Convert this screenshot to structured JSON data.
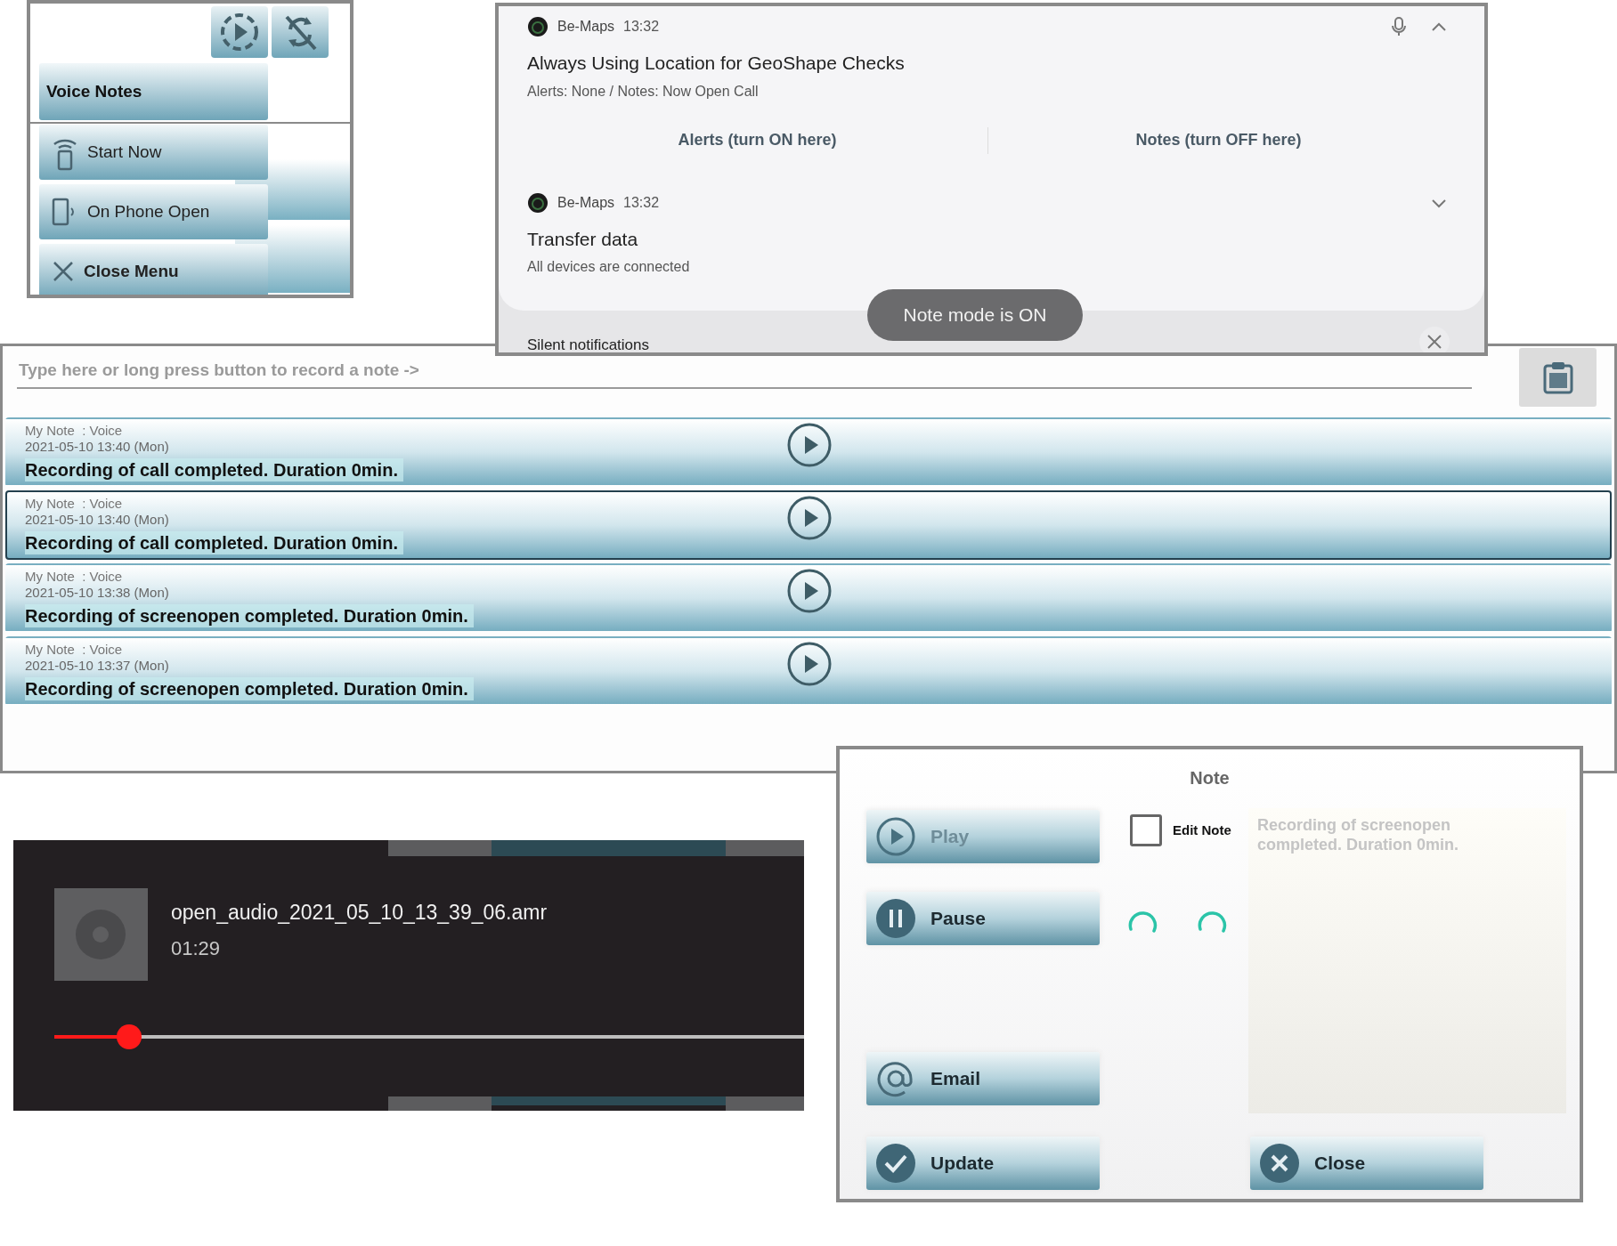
{
  "voice_menu": {
    "toolbar": [
      {
        "kind": "play"
      },
      {
        "kind": "sync_off"
      }
    ],
    "title": "Voice Notes",
    "items": [
      {
        "kind": "broadcast",
        "label": "Start Now"
      },
      {
        "kind": "phone",
        "label": "On Phone Open"
      },
      {
        "kind": "close",
        "label": "Close Menu"
      }
    ]
  },
  "notifications": {
    "items": [
      {
        "app": "Be-Maps",
        "time": "13:32",
        "title": "Always Using Location for GeoShape Checks",
        "text": "Alerts: None / Notes: Now Open Call",
        "expanded": true,
        "actions": [
          "Alerts (turn ON here)",
          "Notes (turn OFF here)"
        ]
      },
      {
        "app": "Be-Maps",
        "time": "13:32",
        "title": "Transfer data",
        "text": "All devices are connected",
        "expanded": false
      }
    ],
    "toast": "Note mode is ON",
    "section": "Silent notifications"
  },
  "notes_list": {
    "input": {
      "placeholder": "Type here or long press button to record a note ->"
    },
    "rows": [
      {
        "label": "My Note  : Voice",
        "date": "2021-05-10 13:40 (Mon)",
        "text": "Recording of call completed. Duration 0min.",
        "selected": false
      },
      {
        "label": "My Note  : Voice",
        "date": "2021-05-10 13:40 (Mon)",
        "text": "Recording of call completed. Duration 0min.",
        "selected": true
      },
      {
        "label": "My Note  : Voice",
        "date": "2021-05-10 13:38 (Mon)",
        "text": "Recording of screenopen completed. Duration 0min.",
        "selected": false
      },
      {
        "label": "My Note  : Voice",
        "date": "2021-05-10 13:37 (Mon)",
        "text": "Recording of screenopen completed. Duration 0min.",
        "selected": false
      }
    ]
  },
  "player": {
    "file": "open_audio_2021_05_10_13_39_06.amr",
    "duration": "01:29",
    "level": 0.1
  },
  "note_dialog": {
    "title": "Note",
    "buttons": [
      {
        "kind": "play",
        "label": "Play",
        "disabled": true
      },
      {
        "kind": "pause",
        "label": "Pause",
        "disabled": false
      },
      {
        "kind": "email",
        "label": "Email",
        "disabled": false
      },
      {
        "kind": "update",
        "label": "Update",
        "disabled": false
      }
    ],
    "edit_note": {
      "label": "Edit Note",
      "checked": false
    },
    "note": {
      "value": "Recording of screenopen completed. Duration 0min.",
      "disabled": true
    },
    "close": {
      "kind": "close",
      "label": "Close",
      "disabled": false
    }
  }
}
